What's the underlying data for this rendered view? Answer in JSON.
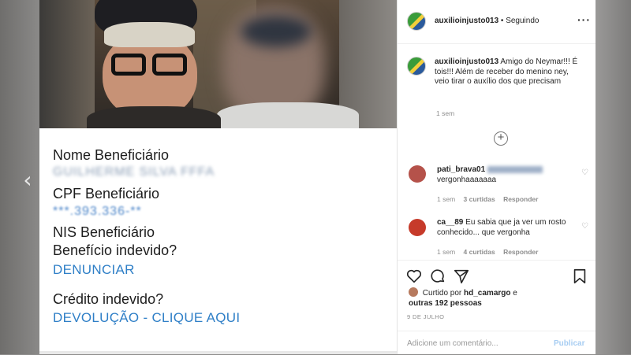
{
  "nav": {
    "prev_arrow": "‹"
  },
  "form": {
    "nome_label": "Nome Beneficiário",
    "nome_value": "GUILHERME SILVA FFFA",
    "cpf_label": "CPF Beneficiário",
    "cpf_value": "***.393.336-**",
    "nis_label": "NIS Beneficiário",
    "beneficio_label": "Benefício indevido?",
    "denunciar_link": "DENUNCIAR",
    "credito_label": "Crédito indevido?",
    "devolucao_link": "DEVOLUÇÃO - CLIQUE AQUI"
  },
  "post": {
    "username": "auxilioinjusto013",
    "follow_status": "• Seguindo",
    "more": "···",
    "caption_text": "Amigo do Neymar!!! É tois!!! Além de receber do menino ney, veio tirar o auxílio dos que precisam",
    "caption_time": "1 sem",
    "load_more": "+",
    "comments": [
      {
        "user": "pati_brava01",
        "text": "vergonhaaaaaaa",
        "time": "1 sem",
        "likes": "3 curtidas",
        "reply": "Responder",
        "avatar_color": "#b5524a"
      },
      {
        "user": "ca__89",
        "text": "Eu sabia que ja ver um rosto conhecido... que vergonha",
        "time": "1 sem",
        "likes": "4 curtidas",
        "reply": "Responder",
        "avatar_color": "#c63a2a"
      }
    ],
    "liked_by_prefix": "Curtido por",
    "liked_by_user": "hd_camargo",
    "liked_by_e": "e",
    "liked_by_others": "outras 192 pessoas",
    "date": "9 DE JULHO",
    "add_comment_placeholder": "Adicione um comentário...",
    "publish_label": "Publicar"
  },
  "colors": {
    "link_blue": "#2f7fc7",
    "publish_disabled": "#a7cdf2"
  },
  "icons": [
    "heart-icon",
    "comment-icon",
    "share-icon",
    "bookmark-icon",
    "more-icon",
    "plus-circle-icon",
    "small-heart-icon"
  ]
}
